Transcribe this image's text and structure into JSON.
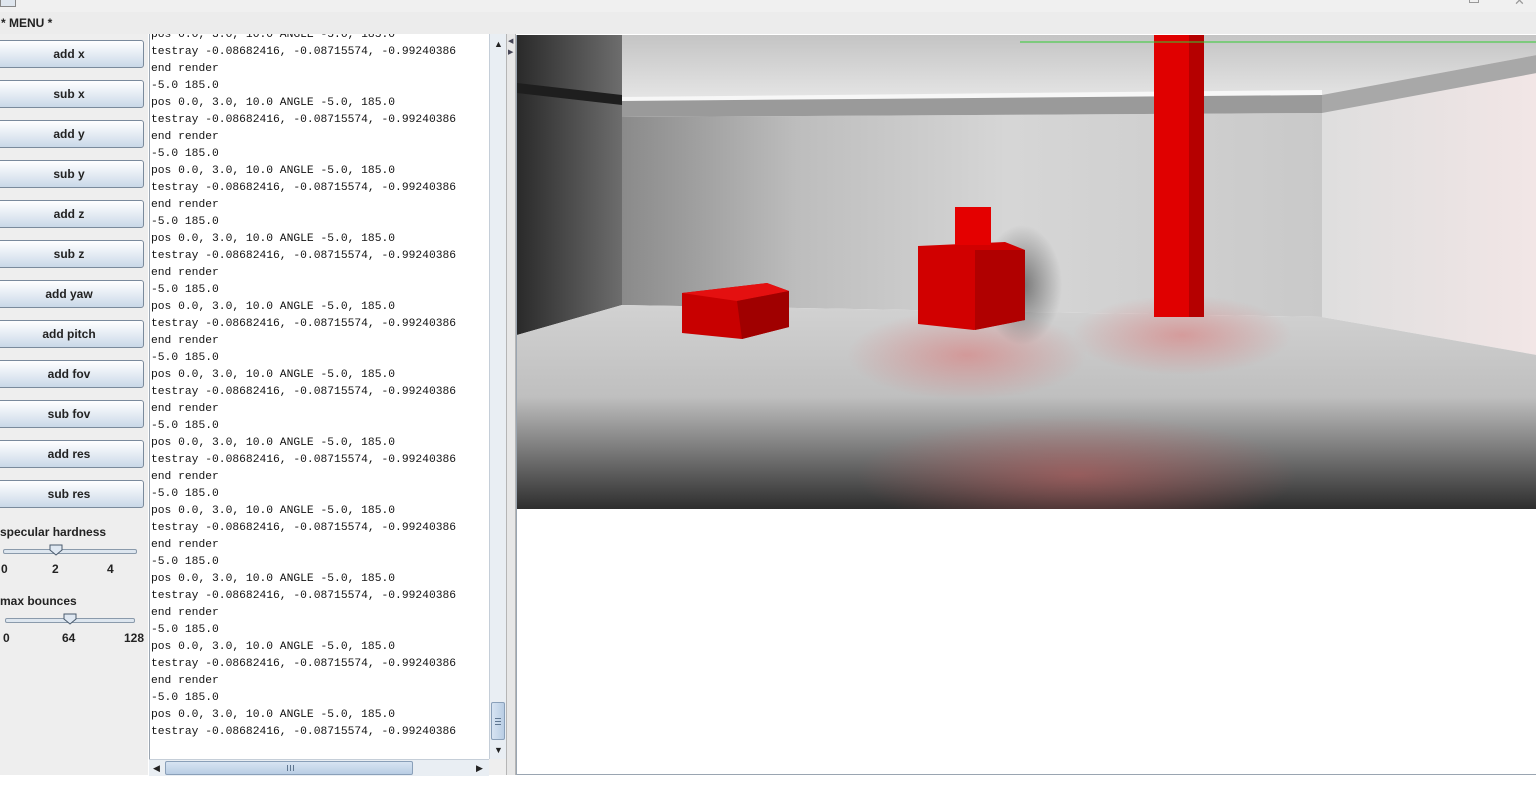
{
  "window": {
    "menu_title": "* MENU *"
  },
  "controls": {
    "buttons": [
      "add x",
      "sub x",
      "add y",
      "sub y",
      "add z",
      "sub z",
      "add yaw",
      "add pitch",
      "add fov",
      "sub fov",
      "add res",
      "sub res"
    ],
    "specular": {
      "label": "specular hardness",
      "ticks": [
        "0",
        "2",
        "4"
      ],
      "value": 2,
      "min": 0,
      "max": 4
    },
    "bounces": {
      "label": "max bounces",
      "ticks": [
        "0",
        "64",
        "128"
      ],
      "value": 64,
      "min": 0,
      "max": 128
    }
  },
  "log": {
    "lines": [
      "pos 0.0, 3.0, 10.0 ANGLE -5.0, 185.0",
      "testray -0.08682416, -0.08715574, -0.99240386",
      "end render",
      "-5.0 185.0",
      "pos 0.0, 3.0, 10.0 ANGLE -5.0, 185.0",
      "testray -0.08682416, -0.08715574, -0.99240386",
      "end render",
      "-5.0 185.0",
      "pos 0.0, 3.0, 10.0 ANGLE -5.0, 185.0",
      "testray -0.08682416, -0.08715574, -0.99240386",
      "end render",
      "-5.0 185.0",
      "pos 0.0, 3.0, 10.0 ANGLE -5.0, 185.0",
      "testray -0.08682416, -0.08715574, -0.99240386",
      "end render",
      "-5.0 185.0",
      "pos 0.0, 3.0, 10.0 ANGLE -5.0, 185.0",
      "testray -0.08682416, -0.08715574, -0.99240386",
      "end render",
      "-5.0 185.0",
      "pos 0.0, 3.0, 10.0 ANGLE -5.0, 185.0",
      "testray -0.08682416, -0.08715574, -0.99240386",
      "end render",
      "-5.0 185.0",
      "pos 0.0, 3.0, 10.0 ANGLE -5.0, 185.0",
      "testray -0.08682416, -0.08715574, -0.99240386",
      "end render",
      "-5.0 185.0",
      "pos 0.0, 3.0, 10.0 ANGLE -5.0, 185.0",
      "testray -0.08682416, -0.08715574, -0.99240386",
      "end render",
      "-5.0 185.0",
      "pos 0.0, 3.0, 10.0 ANGLE -5.0, 185.0",
      "testray -0.08682416, -0.08715574, -0.99240386",
      "end render",
      "-5.0 185.0",
      "pos 0.0, 3.0, 10.0 ANGLE -5.0, 185.0",
      "testray -0.08682416, -0.08715574, -0.99240386",
      "end render",
      "-5.0 185.0",
      "pos 0.0, 3.0, 10.0 ANGLE -5.0, 185.0",
      "testray -0.08682416, -0.08715574, -0.99240386"
    ]
  },
  "colors": {
    "object": "#e00000",
    "progress_line": "#33cc33"
  }
}
